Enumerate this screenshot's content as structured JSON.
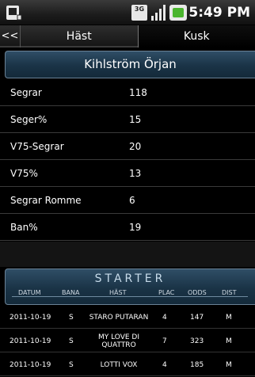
{
  "status_bar": {
    "time": "5:49 PM",
    "network": "3G"
  },
  "tabs": {
    "back_label": "<<",
    "items": [
      {
        "label": "Häst"
      },
      {
        "label": "Kusk"
      }
    ]
  },
  "driver": {
    "name": "Kihlström Örjan"
  },
  "stats": [
    {
      "label": "Segrar",
      "value": "118"
    },
    {
      "label": "Seger%",
      "value": "15"
    },
    {
      "label": "V75-Segrar",
      "value": "20"
    },
    {
      "label": "V75%",
      "value": "13"
    },
    {
      "label": "Segrar Romme",
      "value": "6"
    },
    {
      "label": "Ban%",
      "value": "19"
    }
  ],
  "starter": {
    "title": "STARTER",
    "columns": {
      "datum": "DATUM",
      "bana": "BANA",
      "hast": "HÄST",
      "plac": "PLAC",
      "odds": "ODDS",
      "dist": "DIST"
    },
    "rows": [
      {
        "datum": "2011-10-19",
        "bana": "S",
        "hast": "STARO PUTARAN",
        "plac": "4",
        "odds": "147",
        "dist": "M"
      },
      {
        "datum": "2011-10-19",
        "bana": "S",
        "hast": "MY LOVE DI QUATTRO",
        "plac": "7",
        "odds": "323",
        "dist": "M"
      },
      {
        "datum": "2011-10-19",
        "bana": "S",
        "hast": "LOTTI VOX",
        "plac": "4",
        "odds": "185",
        "dist": "M"
      }
    ]
  }
}
